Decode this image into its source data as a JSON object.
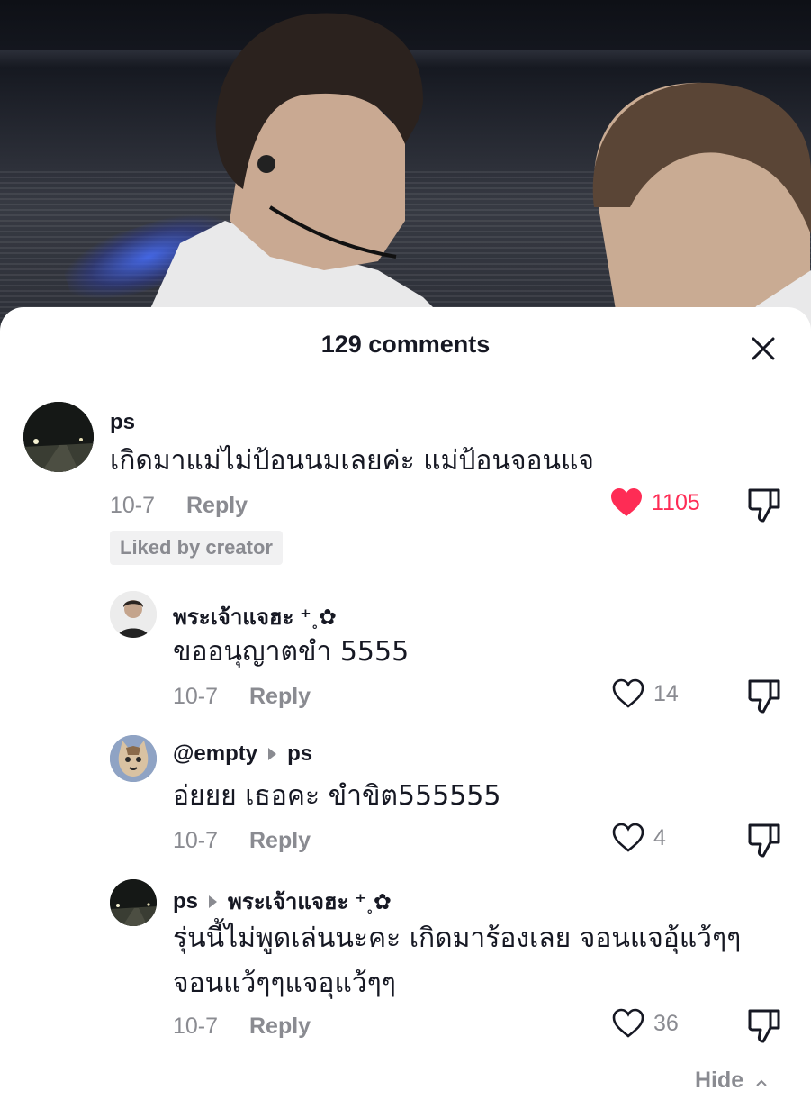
{
  "header": {
    "title": "129 comments"
  },
  "comments": [
    {
      "username": "ps",
      "text": "เกิดมาแม่ไม่ป้อนนมเลยค่ะ แม่ป้อนจอนแจ",
      "date": "10-7",
      "reply_label": "Reply",
      "likes": "1105",
      "liked": true,
      "badge": "Liked by creator",
      "avatar": "night-road-avatar"
    },
    {
      "username": "พระเจ้าแจฮะ ⁺˳✿",
      "text": "ขออนุญาตขำ 5555",
      "date": "10-7",
      "reply_label": "Reply",
      "likes": "14",
      "liked": false,
      "avatar": "person-avatar"
    },
    {
      "username": "@empty",
      "reply_to": "ps",
      "text": "อ่ยยย เธอคะ ขำขิต555555",
      "date": "10-7",
      "reply_label": "Reply",
      "likes": "4",
      "liked": false,
      "avatar": "cat-avatar"
    },
    {
      "username": "ps",
      "reply_to": "พระเจ้าแจฮะ ⁺˳✿",
      "text_line1": "รุ่นนี้ไม่พูดเล่นนะคะ เกิดมาร้องเลย จอนแจอุ้แว้ๆๆ",
      "text_line2": "จอนแว้ๆๆแจอุแว้ๆๆ",
      "date": "10-7",
      "reply_label": "Reply",
      "likes": "36",
      "liked": false,
      "avatar": "night-road-avatar"
    }
  ],
  "footer": {
    "hide_label": "Hide"
  },
  "colors": {
    "accent": "#fe2c55",
    "text": "#161823",
    "muted": "#8a8b91"
  }
}
